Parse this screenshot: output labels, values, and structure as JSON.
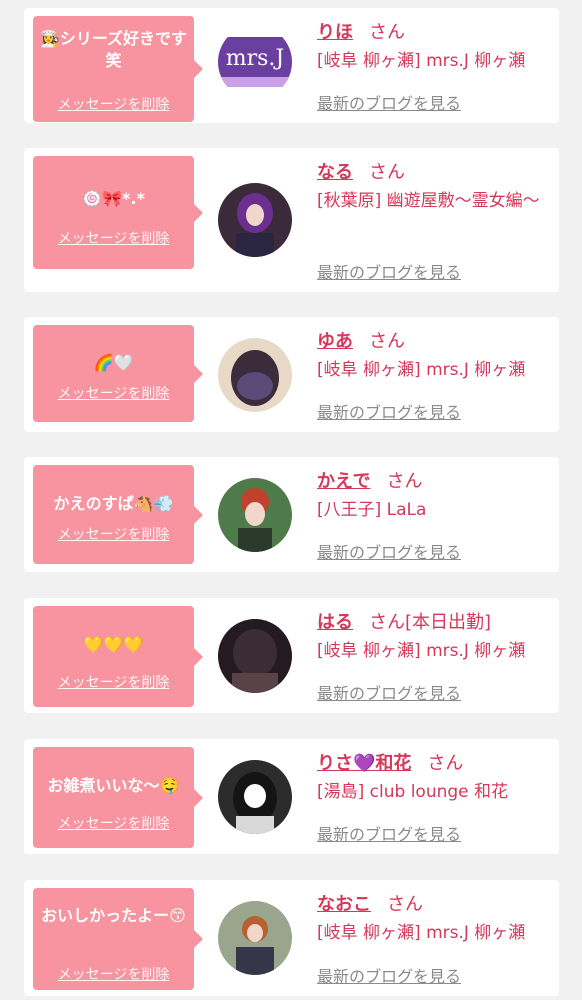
{
  "delete_label": "メッセージを削除",
  "san_label": "さん",
  "blog_label": "最新のブログを見る",
  "cards": [
    {
      "message": "👩‍🍳シリーズ好きです笑",
      "name": "りほ",
      "status": "",
      "shop": "[岐阜 柳ヶ瀬] mrs.J 柳ヶ瀬",
      "avatar_icon": "mrsj-logo-avatar"
    },
    {
      "message": "🍥🎀*.*",
      "name": "なる",
      "status": "",
      "shop": "[秋葉原] 幽遊屋敷〜霊女編〜",
      "avatar_icon": "cosplay-avatar"
    },
    {
      "message": "🌈🤍",
      "name": "ゆあ",
      "status": "",
      "shop": "[岐阜 柳ヶ瀬] mrs.J 柳ヶ瀬",
      "avatar_icon": "hair-avatar"
    },
    {
      "message": "かえのすぱ🐴💨",
      "name": "かえで",
      "status": "",
      "shop": "[八王子] LaLa",
      "avatar_icon": "outdoor-avatar"
    },
    {
      "message": "💛💛💛",
      "name": "はる",
      "status": "[本日出勤]",
      "shop": "[岐阜 柳ヶ瀬] mrs.J 柳ヶ瀬",
      "avatar_icon": "night-avatar"
    },
    {
      "message": "お雑煮いいな〜🤤",
      "name": "りさ💜和花",
      "status": "",
      "shop": "[湯島] club lounge 和花",
      "avatar_icon": "selfie-avatar"
    },
    {
      "message": "おいしかったよー😙",
      "name": "なおこ",
      "status": "",
      "shop": "[岐阜 柳ヶ瀬] mrs.J 柳ヶ瀬",
      "avatar_icon": "street-avatar"
    }
  ],
  "colors": {
    "accent": "#d6385a",
    "bubble": "#f7949f",
    "background": "#f1f1f1"
  }
}
